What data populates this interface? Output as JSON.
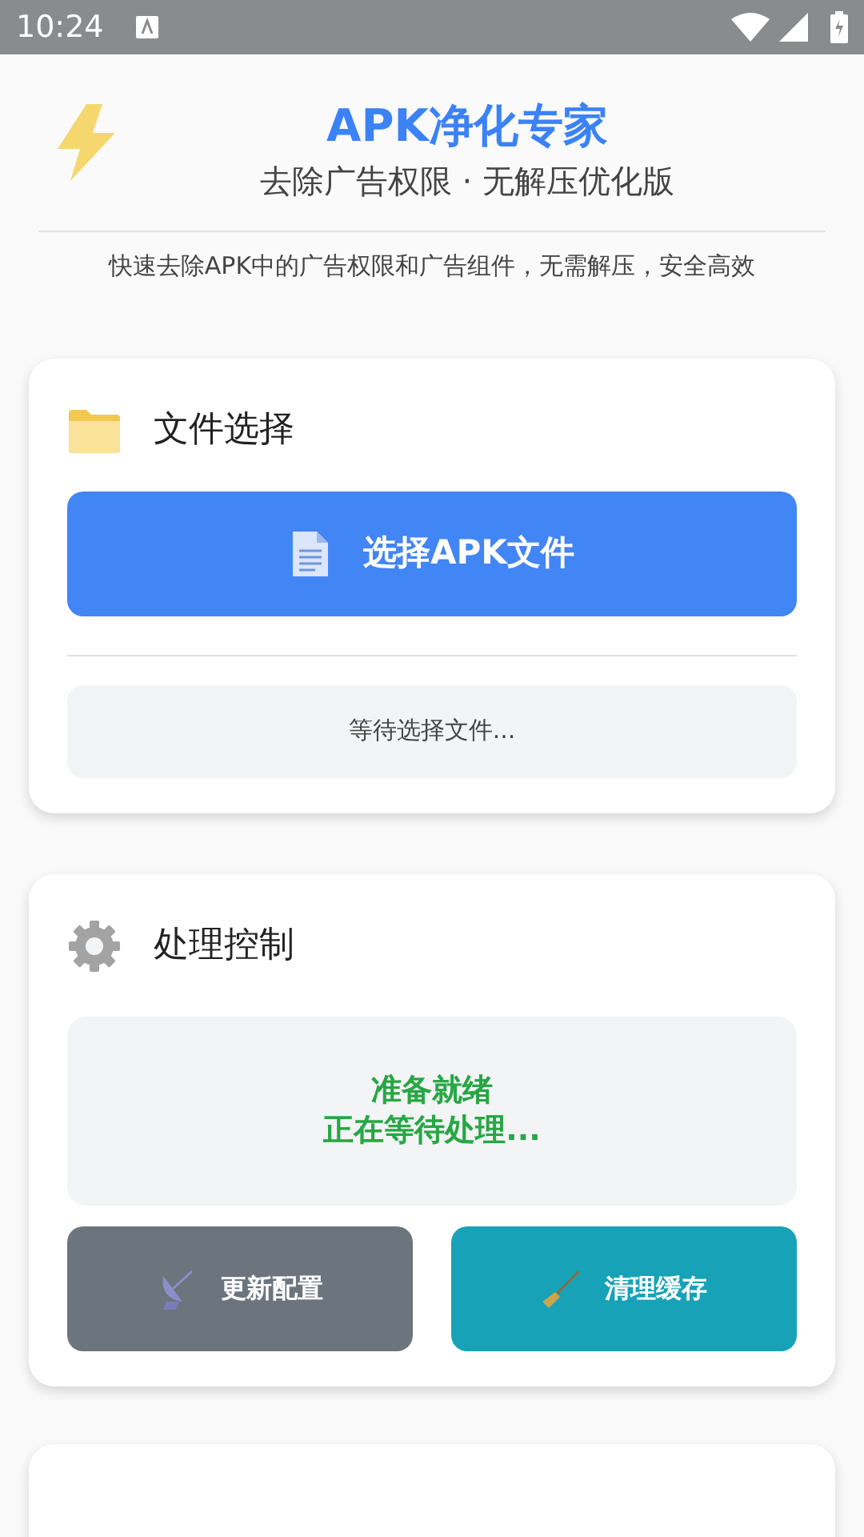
{
  "status_bar": {
    "time": "10:24"
  },
  "header": {
    "title": "APK净化专家",
    "subtitle": "去除广告权限 · 无解压优化版",
    "description": "快速去除APK中的广告权限和广告组件，无需解压，安全高效"
  },
  "file_card": {
    "title": "文件选择",
    "select_button": "选择APK文件",
    "status": "等待选择文件..."
  },
  "control_card": {
    "title": "处理控制",
    "status_lines": [
      "准备就绪",
      "正在等待处理..."
    ],
    "buttons": [
      {
        "label": "更新配置",
        "kind": "update"
      },
      {
        "label": "清理缓存",
        "kind": "clear"
      }
    ]
  }
}
